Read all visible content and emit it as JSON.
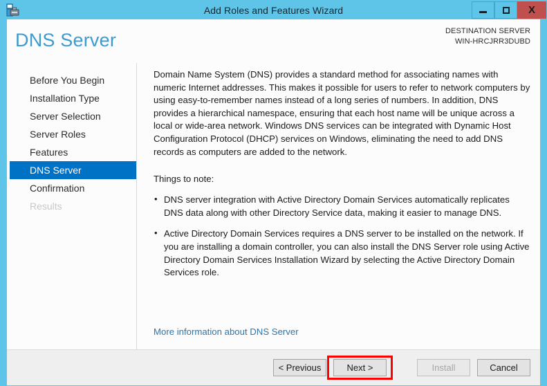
{
  "window": {
    "title": "Add Roles and Features Wizard",
    "app_icon": "server-manager-icon",
    "controls": {
      "minimize": "minimize-icon",
      "maximize": "maximize-icon",
      "close": "X"
    }
  },
  "header": {
    "page_title": "DNS Server",
    "destination_label": "DESTINATION SERVER",
    "destination_name": "WIN-HRCJRR3DUBD"
  },
  "sidebar": {
    "items": [
      {
        "label": "Before You Begin",
        "state": "normal"
      },
      {
        "label": "Installation Type",
        "state": "normal"
      },
      {
        "label": "Server Selection",
        "state": "normal"
      },
      {
        "label": "Server Roles",
        "state": "normal"
      },
      {
        "label": "Features",
        "state": "normal"
      },
      {
        "label": "DNS Server",
        "state": "selected"
      },
      {
        "label": "Confirmation",
        "state": "normal"
      },
      {
        "label": "Results",
        "state": "disabled"
      }
    ]
  },
  "content": {
    "intro": "Domain Name System (DNS) provides a standard method for associating names with numeric Internet addresses. This makes it possible for users to refer to network computers by using easy-to-remember names instead of a long series of numbers. In addition, DNS provides a hierarchical namespace, ensuring that each host name will be unique across a local or wide-area network. Windows DNS services can be integrated with Dynamic Host Configuration Protocol (DHCP) services on Windows, eliminating the need to add DNS records as computers are added to the network.",
    "notes_heading": "Things to note:",
    "notes": [
      "DNS server integration with Active Directory Domain Services automatically replicates DNS data along with other Directory Service data, making it easier to manage DNS.",
      "Active Directory Domain Services requires a DNS server to be installed on the network. If you are installing a domain controller, you can also install the DNS Server role using Active Directory Domain Services Installation Wizard by selecting the Active Directory Domain Services role."
    ],
    "more_info_link": "More information about DNS Server"
  },
  "footer": {
    "previous": "< Previous",
    "next": "Next >",
    "install": "Install",
    "cancel": "Cancel",
    "install_enabled": false,
    "highlighted_button": "Next >"
  },
  "colors": {
    "titlebar": "#5fc5e8",
    "close_button": "#c0504d",
    "accent_title": "#3c9bd1",
    "selection": "#0072c6",
    "link": "#2e74a8",
    "highlight_outline": "#ff0000",
    "footer_bg": "#efefef"
  }
}
